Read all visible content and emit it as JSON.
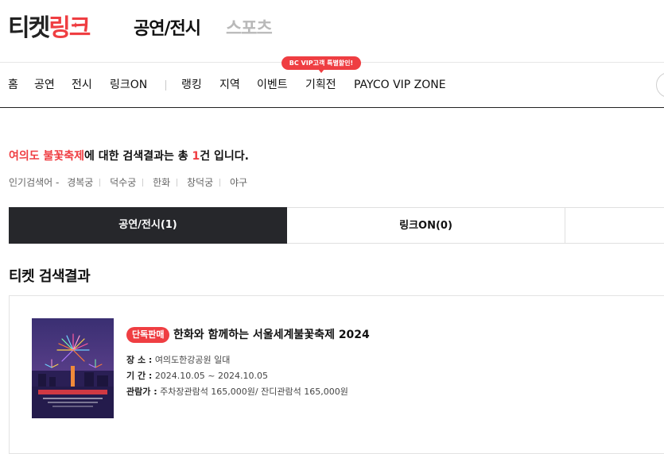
{
  "brand": {
    "logo_dark": "티켓",
    "logo_red": "링크"
  },
  "header": {
    "tab_active": "공연/전시",
    "tab_inactive": "스포츠"
  },
  "nav": {
    "items": [
      "홈",
      "공연",
      "전시",
      "링크ON",
      "랭킹",
      "지역",
      "이벤트",
      "기획전",
      "PAYCO VIP ZONE"
    ],
    "promo_badge": "BC VIP고객 특별할인!"
  },
  "search": {
    "keyword": "여의도 불꽃축제",
    "summary_mid": "에 대한 검색결과는 총 ",
    "count": "1",
    "summary_end": "건 입니다.",
    "popular_label": "인기검색어 -",
    "popular_keywords": [
      "경복궁",
      "덕수궁",
      "한화",
      "창덕궁",
      "야구"
    ]
  },
  "tabs": [
    {
      "label": "공연/전시(1)",
      "active": true
    },
    {
      "label": "링크ON(0)",
      "active": false
    },
    {
      "label": "",
      "active": false
    }
  ],
  "section_title": "티켓 검색결과",
  "result": {
    "badge": "단독판매",
    "title": "한화와 함께하는 서울세계불꽃축제 2024",
    "venue_label": "장 소 :",
    "venue": "여의도한강공원 일대",
    "period_label": "기 간 :",
    "period": "2024.10.05 ~ 2024.10.05",
    "price_label": "관람가 :",
    "price": "주차장관람석 165,000원/ 잔디관람석 165,000원"
  },
  "colors": {
    "accent": "#ef3e42",
    "dark_tab": "#26272b",
    "poster_bg": "#3b2f6b"
  },
  "icons": {
    "search": "search-icon",
    "promo_arrow": "triangle-down"
  }
}
